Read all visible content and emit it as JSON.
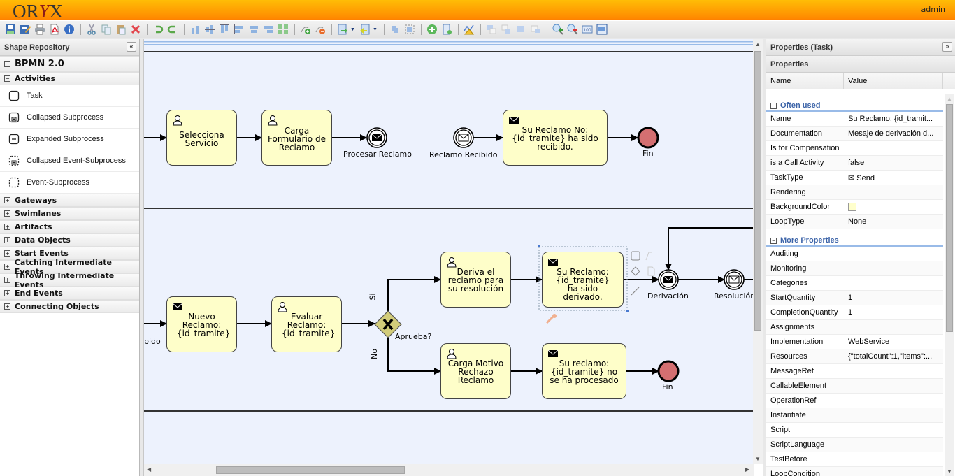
{
  "app": {
    "logo": "ORYX",
    "user": "admin"
  },
  "toolbar": {
    "buttons": [
      "save-icon",
      "save-as-icon",
      "print-icon",
      "pdf-export-icon",
      "info-icon",
      "cut-icon",
      "copy-icon",
      "paste-icon",
      "delete-icon",
      "undo-icon",
      "redo-icon",
      "align-bottom-icon",
      "align-middle-icon",
      "align-top-icon",
      "align-left-icon",
      "align-center-icon",
      "align-right-icon",
      "group-icon",
      "add-docker-icon",
      "remove-docker-icon",
      "import-icon",
      "export-icon",
      "group-shapes-icon",
      "ungroup-shapes-icon",
      "add-shape-icon",
      "new-page-icon",
      "validate-icon",
      "bring-to-front-icon",
      "bring-forward-icon",
      "send-backward-icon",
      "send-to-back-icon",
      "zoom-in-icon",
      "zoom-out-icon",
      "zoom-100-icon",
      "zoom-fit-icon"
    ]
  },
  "shape_repository": {
    "title": "Shape Repository",
    "stencil_set": "BPMN 2.0",
    "expanded_group": "Activities",
    "activities": [
      "Task",
      "Collapsed Subprocess",
      "Expanded Subprocess",
      "Collapsed Event-Subprocess",
      "Event-Subprocess"
    ],
    "groups": [
      "Gateways",
      "Swimlanes",
      "Artifacts",
      "Data Objects",
      "Start Events",
      "Catching Intermediate Events",
      "Throwing Intermediate Events",
      "End Events",
      "Connecting Objects"
    ]
  },
  "diagram": {
    "tasks": {
      "selecciona": "Selecciona Servicio",
      "carga_form": "Carga Formulario de Reclamo",
      "su_reclamo_no": "Su Reclamo No: {id_tramite} ha sido recibido.",
      "nuevo": "Nuevo Reclamo: {id_tramite}",
      "evaluar": "Evaluar Reclamo: {id_tramite}",
      "deriva": "Deriva el reclamo para su resolución",
      "derivado": "Su Reclamo: {id_tramite} ha sido derivado.",
      "carga_motivo": "Carga Motivo Rechazo Reclamo",
      "no_procesado": "Su reclamo: {id_tramite} no se ha procesado"
    },
    "events": {
      "procesar": "Procesar Reclamo",
      "recibido": "Reclamo Recibido",
      "fin1": "Fin",
      "recibido_cut": "bido",
      "derivacion": "Derivación",
      "resolucion": "Resolución",
      "fin2": "Fin"
    },
    "gateway": {
      "label": "Aprueba?",
      "yes": "Si",
      "no": "No"
    }
  },
  "properties": {
    "title": "Properties (Task)",
    "subtitle": "Properties",
    "col_name": "Name",
    "col_value": "Value",
    "often_used_label": "Often used",
    "often_used": [
      {
        "k": "Name",
        "v": "Su Reclamo: {id_tramit..."
      },
      {
        "k": "Documentation",
        "v": "Mesaje de derivación d..."
      },
      {
        "k": "Is for Compensation",
        "v": ""
      },
      {
        "k": "is a Call Activity",
        "v": "false"
      },
      {
        "k": "TaskType",
        "v": "✉ Send"
      },
      {
        "k": "Rendering",
        "v": ""
      },
      {
        "k": "BackgroundColor",
        "v": "",
        "color": "#ffffcc"
      },
      {
        "k": "LoopType",
        "v": "None"
      }
    ],
    "more_label": "More Properties",
    "more": [
      {
        "k": "Auditing",
        "v": ""
      },
      {
        "k": "Monitoring",
        "v": ""
      },
      {
        "k": "Categories",
        "v": ""
      },
      {
        "k": "StartQuantity",
        "v": "1"
      },
      {
        "k": "CompletionQuantity",
        "v": "1"
      },
      {
        "k": "Assignments",
        "v": ""
      },
      {
        "k": "Implementation",
        "v": "WebService"
      },
      {
        "k": "Resources",
        "v": "{\"totalCount\":1,\"items\":..."
      },
      {
        "k": "MessageRef",
        "v": ""
      },
      {
        "k": "CallableElement",
        "v": ""
      },
      {
        "k": "OperationRef",
        "v": ""
      },
      {
        "k": "Instantiate",
        "v": ""
      },
      {
        "k": "Script",
        "v": ""
      },
      {
        "k": "ScriptLanguage",
        "v": ""
      },
      {
        "k": "TestBefore",
        "v": ""
      },
      {
        "k": "LoopCondition",
        "v": ""
      }
    ]
  }
}
